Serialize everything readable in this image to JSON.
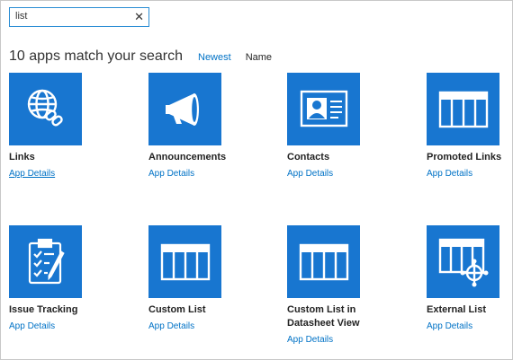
{
  "search": {
    "value": "list",
    "clear_glyph": "✕"
  },
  "results": {
    "count_text": "10 apps match your search",
    "sort_newest": "Newest",
    "sort_name": "Name"
  },
  "apps": [
    {
      "name": "Links",
      "details": "App Details",
      "icon": "globe-link-icon"
    },
    {
      "name": "Announcements",
      "details": "App Details",
      "icon": "megaphone-icon"
    },
    {
      "name": "Contacts",
      "details": "App Details",
      "icon": "contact-card-icon"
    },
    {
      "name": "Promoted Links",
      "details": "App Details",
      "icon": "list-grid-icon"
    },
    {
      "name": "Issue Tracking",
      "details": "App Details",
      "icon": "clipboard-checklist-icon"
    },
    {
      "name": "Custom List",
      "details": "App Details",
      "icon": "list-grid-icon"
    },
    {
      "name": "Custom List in Datasheet View",
      "details": "App Details",
      "icon": "list-grid-icon"
    },
    {
      "name": "External List",
      "details": "App Details",
      "icon": "external-list-icon"
    }
  ],
  "colors": {
    "tile": "#1876d0",
    "link": "#0072c6",
    "search_border": "#2a8dd4"
  }
}
